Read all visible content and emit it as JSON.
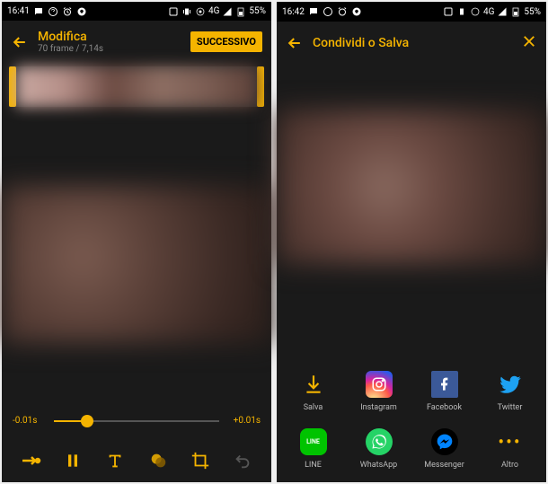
{
  "left": {
    "status": {
      "time": "16:41",
      "net": "4G",
      "battery": "55%"
    },
    "header": {
      "title": "Modifica",
      "subtitle": "70 frame / 7,14s",
      "next": "SUCCESSIVO"
    },
    "scrubber": {
      "left": "-0.01s",
      "right": "+0.01s"
    }
  },
  "right": {
    "status": {
      "time": "16:42",
      "net": "4G",
      "battery": "55%"
    },
    "header": {
      "title": "Condividi o Salva"
    },
    "share": [
      {
        "name": "salva",
        "label": "Salva"
      },
      {
        "name": "instagram",
        "label": "Instagram"
      },
      {
        "name": "facebook",
        "label": "Facebook"
      },
      {
        "name": "twitter",
        "label": "Twitter"
      },
      {
        "name": "line",
        "label": "LINE"
      },
      {
        "name": "whatsapp",
        "label": "WhatsApp"
      },
      {
        "name": "messenger",
        "label": "Messenger"
      },
      {
        "name": "altro",
        "label": "Altro"
      }
    ]
  }
}
